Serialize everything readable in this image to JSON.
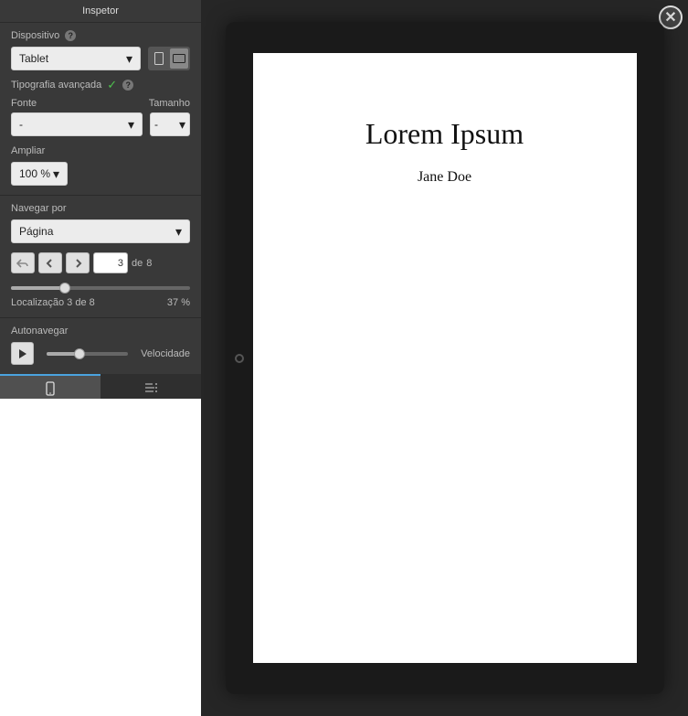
{
  "inspector": {
    "title": "Inspetor",
    "device_label": "Dispositivo",
    "device_value": "Tablet",
    "typography_label": "Tipografia avançada",
    "font_label": "Fonte",
    "size_label": "Tamanho",
    "font_value": "-",
    "size_value": "-",
    "zoom_label": "Ampliar",
    "zoom_value": "100 %",
    "navigate_label": "Navegar por",
    "navigate_value": "Página",
    "page_value": "3",
    "of_label": "de",
    "total_pages": "8",
    "location_text": "Localização 3 de 8",
    "percent_text": "37 %",
    "autonav_label": "Autonavegar",
    "speed_label": "Velocidade"
  },
  "preview": {
    "title": "Lorem Ipsum",
    "author": "Jane Doe"
  }
}
